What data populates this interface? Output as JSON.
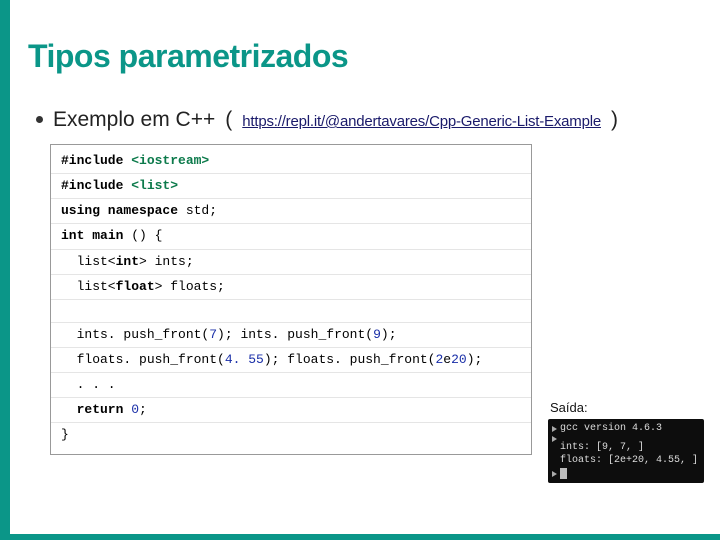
{
  "title": "Tipos parametrizados",
  "bullet": {
    "text": "Exemplo em C++",
    "open": "(",
    "link": "https://repl.it/@andertavares/Cpp-Generic-List-Example",
    "close": " )"
  },
  "code": {
    "l1a": "#include ",
    "l1b": "<iostream>",
    "l2a": "#include ",
    "l2b": "<list>",
    "l3a": "using namespace ",
    "l3b": "std;",
    "l4a": "int ",
    "l4b": "main",
    "l4c": " () {",
    "l5a": "  list<",
    "l5b": "int",
    "l5c": "> ints;",
    "l6a": "  list<",
    "l6b": "float",
    "l6c": "> floats;",
    "l7a": "  ints. push_front(",
    "l7b": "7",
    "l7c": "); ints. push_front(",
    "l7d": "9",
    "l7e": ");",
    "l8a": "  floats. push_front(",
    "l8b": "4. 55",
    "l8c": "); floats. push_front(",
    "l8d": "2",
    "l8e": "e",
    "l8f": "20",
    "l8g": ");",
    "l9": "  . . .",
    "l10a": "  return ",
    "l10b": "0",
    "l10c": ";",
    "l11": "}"
  },
  "saida": {
    "label": "Saída:",
    "t1": "gcc version 4.6.3",
    "t2": "",
    "t3": "ints: [9, 7, ]",
    "t4": "floats: [2e+20, 4.55, ]"
  }
}
